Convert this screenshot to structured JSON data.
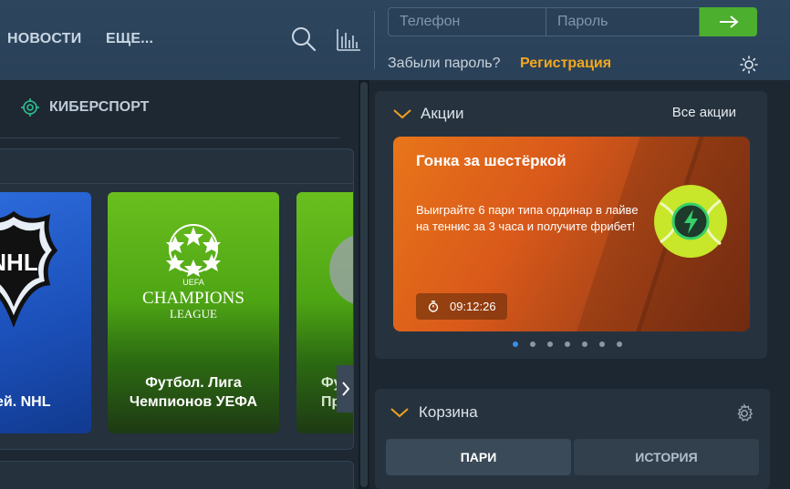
{
  "header": {
    "nav": [
      {
        "label": "НОВОСТИ"
      },
      {
        "label": "ЕЩЕ..."
      }
    ],
    "login": {
      "phone_placeholder": "Телефон",
      "password_placeholder": "Пароль"
    },
    "forgot_password": "Забыли пароль?",
    "register": "Регистрация",
    "icons": [
      "search-icon",
      "stats-icon",
      "arrow-right-icon",
      "sun-icon"
    ]
  },
  "left": {
    "esport_label": "КИБЕРСПОРТ",
    "cards": [
      {
        "title": "...ей. NHL",
        "text": "ей. NHL"
      },
      {
        "title": "Футбол. Лига Чемпионов УЕФА",
        "line1": "Футбол. Лига",
        "line2": "Чемпионов УЕФА"
      },
      {
        "line1": "Фут",
        "line2": "Пр"
      }
    ]
  },
  "promos": {
    "title": "Акции",
    "all_link": "Все акции",
    "banner": {
      "title": "Гонка за шестёркой",
      "text": "Выиграйте 6 пари типа ординар в лайве на теннис за 3 часа и получите фрибет!",
      "timer": "09:12:26"
    },
    "dots_total": 7,
    "active_dot": 1
  },
  "cart": {
    "title": "Корзина",
    "tabs": [
      {
        "label": "ПАРИ",
        "active": true
      },
      {
        "label": "ИСТОРИЯ",
        "active": false
      }
    ]
  },
  "colors": {
    "accent_green": "#4caf2e",
    "register_orange": "#f3a81e",
    "chevron_orange": "#f0a020"
  }
}
